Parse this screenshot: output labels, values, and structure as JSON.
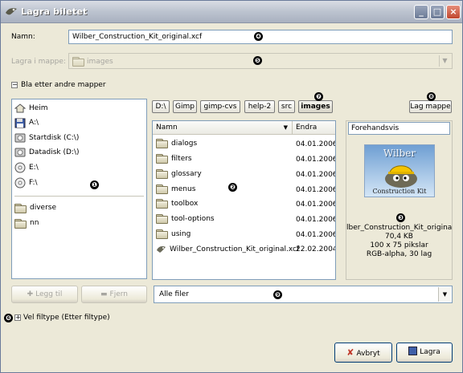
{
  "window": {
    "title": "Lagra biletet"
  },
  "name_label": "Namn:",
  "name_value": "Wilber_Construction_Kit_original.xcf",
  "folder_label": "Lagra i mappe:",
  "folder_value": "images",
  "browse_label": "Bla etter andre mapper",
  "places": [
    {
      "label": "Heim",
      "icon": "home-icon"
    },
    {
      "label": "A:\\",
      "icon": "floppy-icon"
    },
    {
      "label": "Startdisk (C:\\)",
      "icon": "hard-disk-icon"
    },
    {
      "label": "Datadisk (D:\\)",
      "icon": "hard-disk-icon"
    },
    {
      "label": "E:\\",
      "icon": "cd-drive-icon"
    },
    {
      "label": "F:\\",
      "icon": "cd-drive-icon"
    }
  ],
  "bookmarks": [
    {
      "label": "diverse",
      "icon": "folder-icon"
    },
    {
      "label": "nn",
      "icon": "folder-icon"
    }
  ],
  "path": [
    "D:\\",
    "Gimp",
    "gimp-cvs",
    "help-2",
    "src",
    "images"
  ],
  "create_folder": "Lag mappe",
  "file_list": {
    "col_name": "Namn",
    "col_modified": "Endra",
    "rows": [
      {
        "name": "dialogs",
        "date": "04.01.2006",
        "type": "folder"
      },
      {
        "name": "filters",
        "date": "04.01.2006",
        "type": "folder"
      },
      {
        "name": "glossary",
        "date": "04.01.2006",
        "type": "folder"
      },
      {
        "name": "menus",
        "date": "04.01.2006",
        "type": "folder"
      },
      {
        "name": "toolbox",
        "date": "04.01.2006",
        "type": "folder"
      },
      {
        "name": "tool-options",
        "date": "04.01.2006",
        "type": "folder"
      },
      {
        "name": "using",
        "date": "04.01.2006",
        "type": "folder"
      },
      {
        "name": "Wilber_Construction_Kit_original.xcf",
        "date": "22.02.2004",
        "type": "file"
      }
    ]
  },
  "preview": {
    "header": "Forehandsvis",
    "image_caption_top": "Wilber",
    "image_caption_bottom": "Construction Kit",
    "filename": "lber_Construction_Kit_original.x",
    "size": "70,4 KB",
    "dimensions": "100 x 75 pikslar",
    "mode": "RGB-alpha, 30 lag"
  },
  "add_button": "Legg til",
  "remove_button": "Fjern",
  "filter_value": "Alle filer",
  "filetype_label": "Vel filtype (Etter filtype)",
  "cancel_button": "Avbryt",
  "save_button": "Lagra",
  "callouts": [
    "❶",
    "❷",
    "❸",
    "❹",
    "❺",
    "❻",
    "❼",
    "❽",
    "❾"
  ],
  "colors": {
    "dialog_bg": "#ece9d8",
    "entry_border": "#7f9db9",
    "xp_button_border": "#003c74",
    "cancel_x": "#c0392b",
    "preview_sky": "#6f9fd3"
  }
}
